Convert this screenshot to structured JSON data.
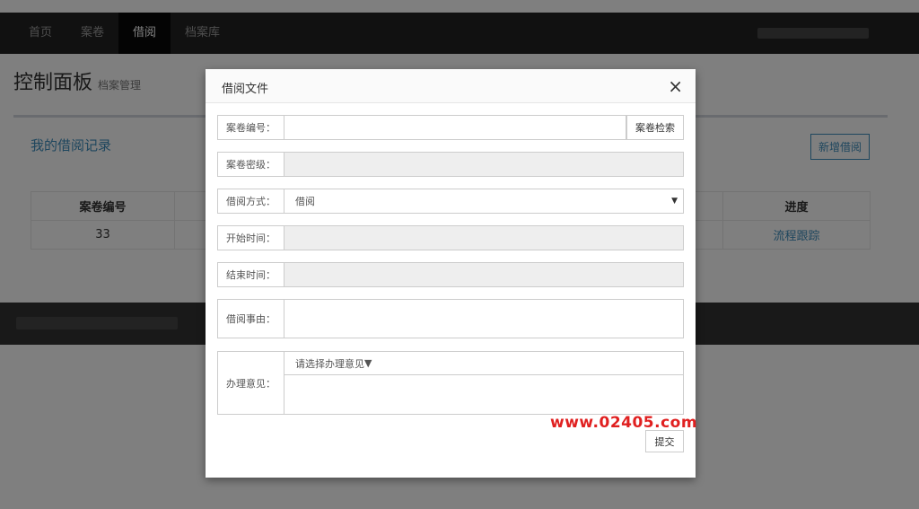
{
  "nav": {
    "items": [
      {
        "label": "首页"
      },
      {
        "label": "案卷"
      },
      {
        "label": "借阅"
      },
      {
        "label": "档案库"
      }
    ]
  },
  "header": {
    "title": "控制面板",
    "subtitle": "档案管理"
  },
  "panel": {
    "title": "我的借阅记录",
    "add_button": "新增借阅",
    "columns": [
      "案卷编号",
      "进度"
    ],
    "row": {
      "case_no": "33",
      "progress": "流程跟踪"
    }
  },
  "modal": {
    "title": "借阅文件",
    "close": "×",
    "fields": {
      "case_no": {
        "label": "案卷编号：",
        "value": "",
        "search_button": "案卷检索"
      },
      "secret_level": {
        "label": "案卷密级：",
        "value": ""
      },
      "method": {
        "label": "借阅方式：",
        "value": "借阅"
      },
      "start_time": {
        "label": "开始时间：",
        "value": ""
      },
      "end_time": {
        "label": "结束时间：",
        "value": ""
      },
      "reason": {
        "label": "借阅事由：",
        "value": ""
      },
      "opinion": {
        "label": "办理意见：",
        "select_value": "请选择办理意见",
        "value": ""
      }
    },
    "watermark": "www.02405.com",
    "submit": "提交"
  }
}
